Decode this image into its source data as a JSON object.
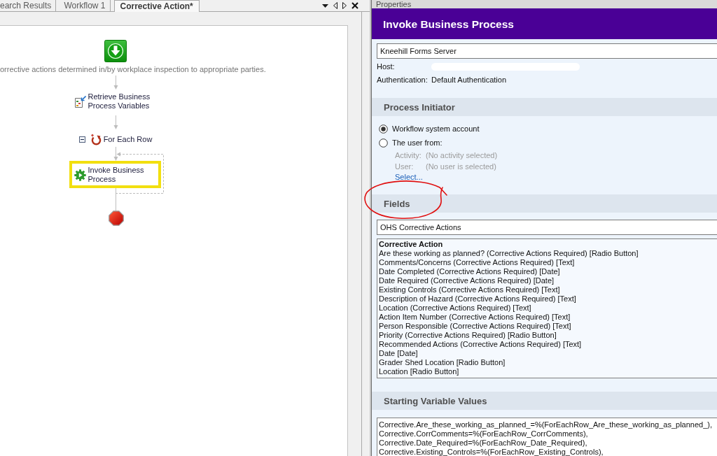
{
  "tabs": [
    {
      "label": "earch Results",
      "selected": false
    },
    {
      "label": "Workflow 1",
      "selected": false
    },
    {
      "label": "Corrective Action*",
      "selected": true
    }
  ],
  "workflow": {
    "description": "orrective actions determined in/by workplace inspection to appropriate parties.",
    "nodes": [
      {
        "kind": "start",
        "selected": false
      },
      {
        "kind": "retrieve",
        "label": "Retrieve Business Process Variables",
        "selected": false
      },
      {
        "kind": "loop",
        "label": "For Each Row",
        "selected": false,
        "expanded": true,
        "children": [
          {
            "kind": "invoke",
            "label": "Invoke Business Process",
            "selected": true
          }
        ]
      },
      {
        "kind": "end",
        "selected": false
      }
    ]
  },
  "properties": {
    "title": "Properties",
    "heading": "Invoke Business Process",
    "server": "Kneehill Forms Server",
    "host": {
      "label": "Host:",
      "redacted": true
    },
    "authentication": {
      "label": "Authentication:",
      "value": "Default Authentication"
    }
  },
  "process_initiator": {
    "title": "Process Initiator",
    "options": [
      {
        "label": "Workflow system account",
        "selected": true
      },
      {
        "label": "The user from:",
        "selected": false
      }
    ],
    "user_fields": [
      {
        "label": "Activity:",
        "value": "(No activity selected)",
        "disabled": true
      },
      {
        "label": "User:",
        "value": "(No user is selected)",
        "disabled": true
      }
    ],
    "select_link": "Select..."
  },
  "fields": {
    "title": "Fields",
    "form": "OHS Corrective Actions",
    "list_heading": "Corrective Action",
    "items": [
      "Are these working as planned? (Corrective Actions Required) [Radio Button]",
      "Comments/Concerns (Corrective Actions Required) [Text]",
      "Date Completed (Corrective Actions Required) [Date]",
      "Date Required (Corrective Actions Required) [Date]",
      "Existing Controls (Corrective Actions Required) [Text]",
      "Description of Hazard (Corrective Actions Required) [Text]",
      "Location (Corrective Actions Required) [Text]",
      "Action Item Number (Corrective Actions Required) [Text]",
      "Person Responsible (Corrective Actions Required) [Text]",
      "Priority (Corrective Actions Required) [Radio Button]",
      "Recommended Actions (Corrective Actions Required) [Text]",
      "Date [Date]",
      "Grader Shed Location [Radio Button]",
      "Location [Radio Button]"
    ]
  },
  "starting_variables": {
    "title": "Starting Variable Values",
    "lines": [
      "Corrective.Are_these_working_as_planned_=%(ForEachRow_Are_these_working_as_planned_),",
      "Corrective.CorrComments=%(ForEachRow_CorrComments),",
      "Corrective.Date_Required=%(ForEachRow_Date_Required),",
      "Corrective.Existing_Controls=%(ForEachRow_Existing_Controls),"
    ]
  }
}
